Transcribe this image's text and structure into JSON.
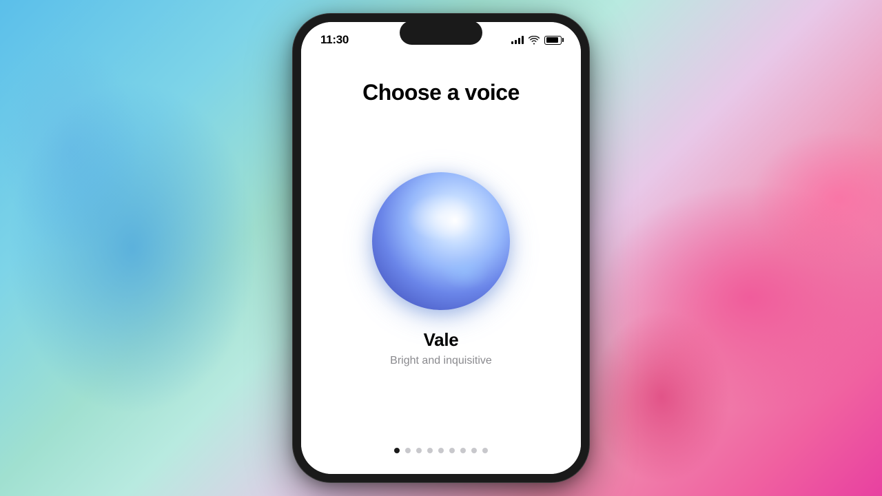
{
  "background": {
    "alt": "Colorful painted background with blue and pink tones"
  },
  "phone": {
    "status_bar": {
      "time": "11:30",
      "signal_alt": "Signal bars",
      "wifi_alt": "WiFi",
      "battery_alt": "Battery"
    },
    "screen": {
      "title": "Choose a voice",
      "voice": {
        "name": "Vale",
        "description": "Bright and inquisitive",
        "orb_alt": "Voice orb visualization"
      },
      "pagination": {
        "total_dots": 9,
        "active_index": 0
      }
    }
  }
}
